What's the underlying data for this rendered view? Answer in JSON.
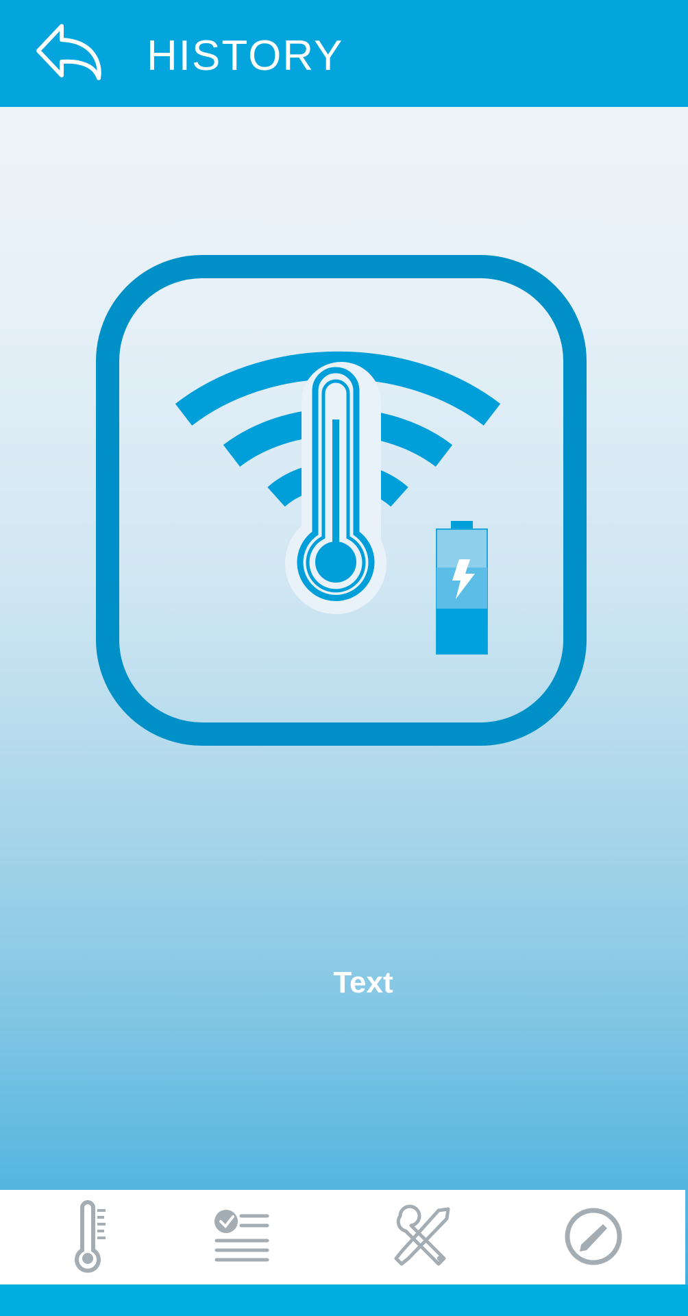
{
  "header": {
    "title": "HISTORY",
    "back_icon": "back-arrow-icon",
    "background_color": "#04a4dc"
  },
  "main": {
    "logo_icon": "wifi-thermometer-battery-icon",
    "accent_color": "#009fda",
    "text": "Text"
  },
  "bottom_nav": {
    "items": [
      {
        "icon": "thermometer-icon"
      },
      {
        "icon": "checklist-icon"
      },
      {
        "icon": "tools-icon"
      },
      {
        "icon": "compass-icon"
      }
    ],
    "icon_color": "#a4adb3"
  }
}
